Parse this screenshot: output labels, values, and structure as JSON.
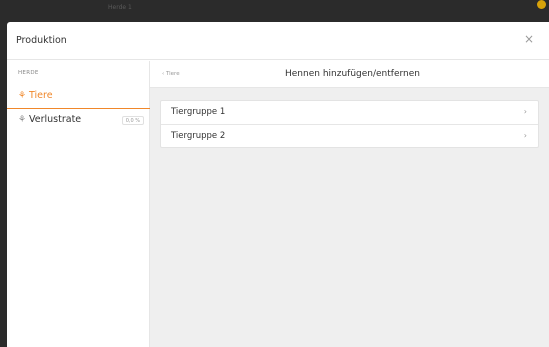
{
  "topbar": {
    "title": "Herde 1"
  },
  "modal": {
    "title": "Produktion",
    "close_glyph": "×"
  },
  "sidebar": {
    "section_label": "HERDE",
    "items": [
      {
        "label": "Tiere",
        "icon": "hen-icon",
        "icon_glyph": "⚘",
        "active": true
      },
      {
        "label": "Verlustrate",
        "icon": "hen-icon",
        "icon_glyph": "⚘",
        "badge": "0,0 %",
        "active": false
      }
    ]
  },
  "main": {
    "back_label": "‹ Tiere",
    "title": "Hennen hinzufügen/entfernen",
    "groups": [
      {
        "label": "Tiergruppe 1",
        "chevron": "›"
      },
      {
        "label": "Tiergruppe 2",
        "chevron": "›"
      }
    ]
  },
  "colors": {
    "accent": "#f0872a",
    "background_dark": "#2b2b2b",
    "content_bg": "#efefef"
  }
}
